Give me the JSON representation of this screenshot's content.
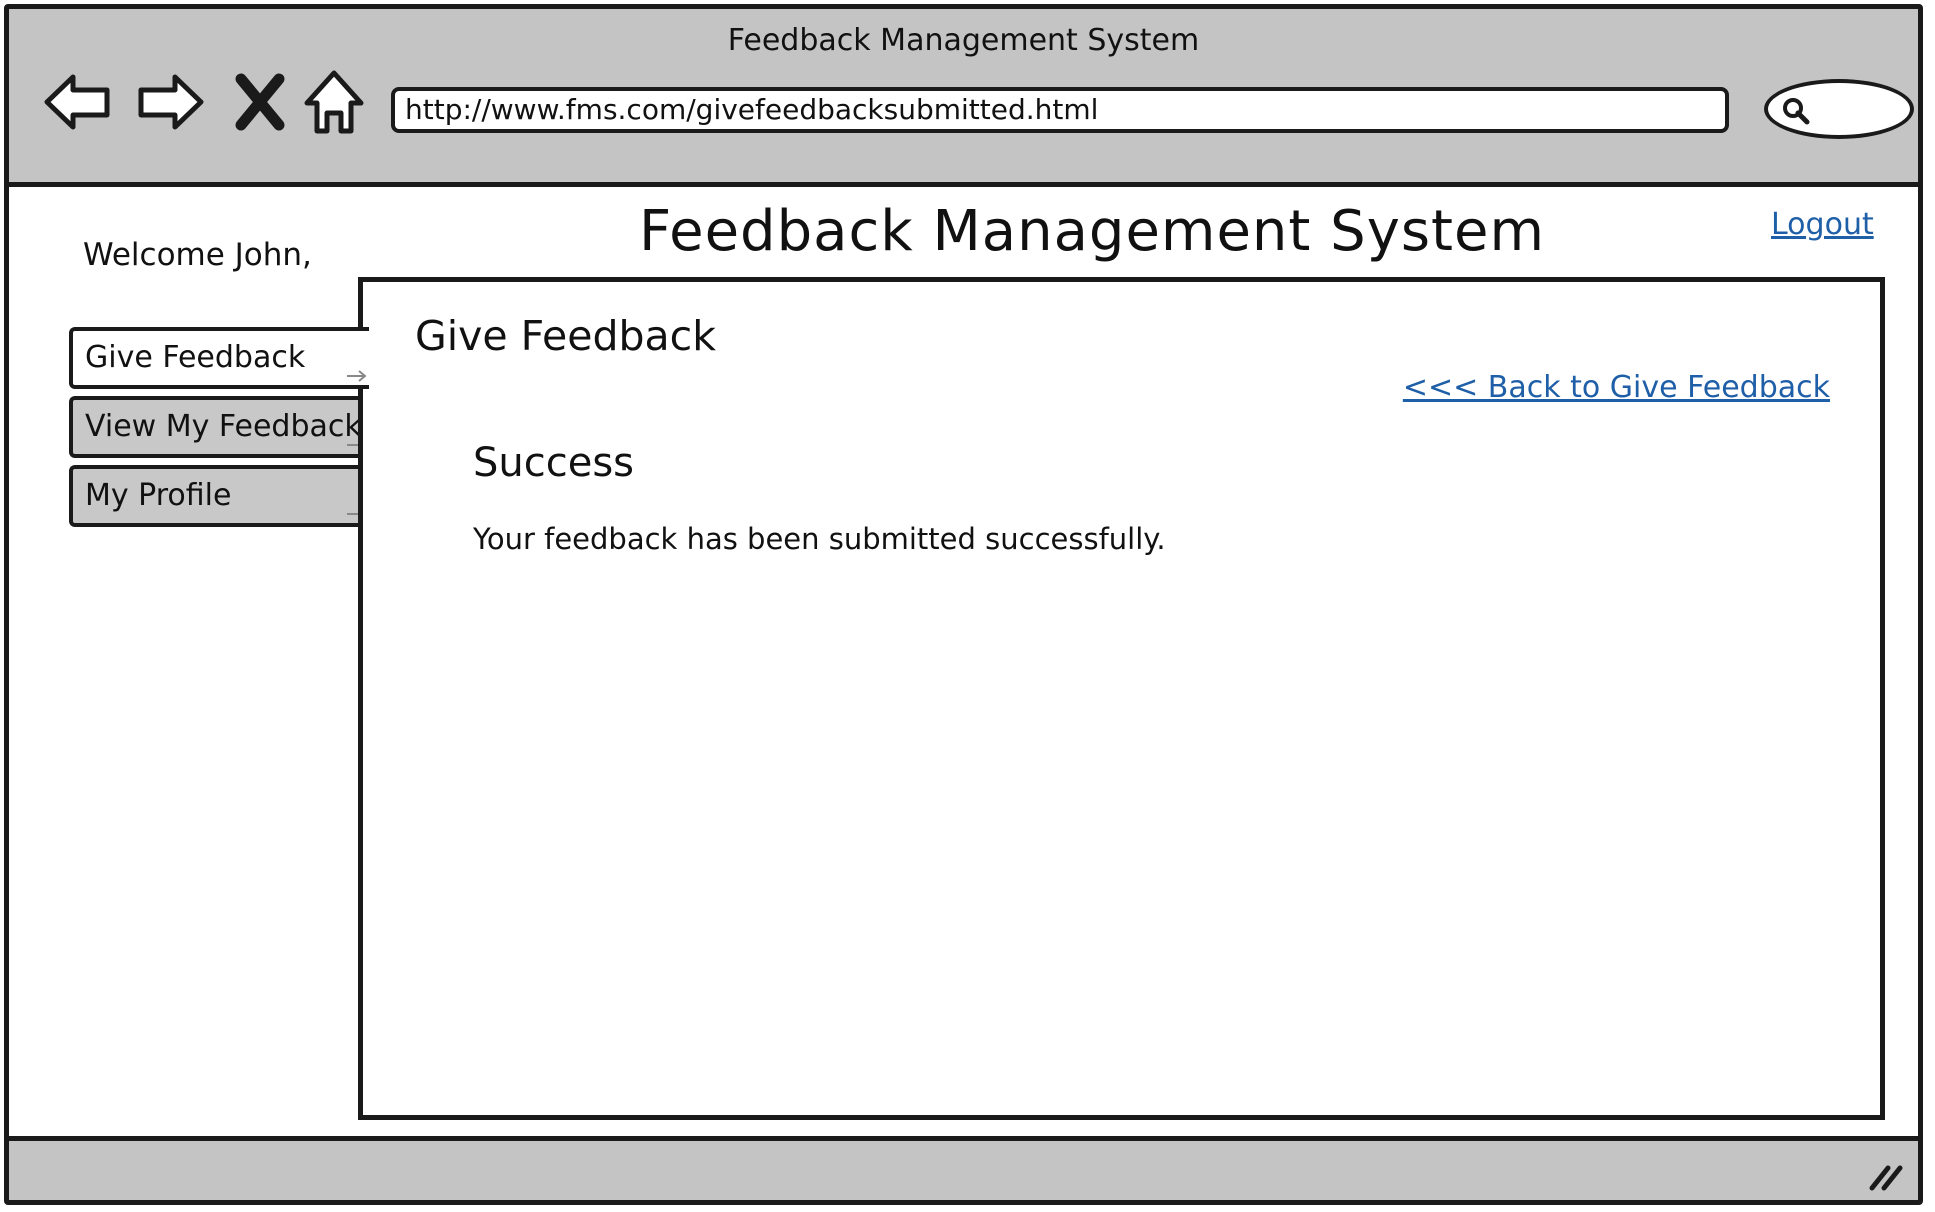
{
  "window": {
    "title": "Feedback Management System"
  },
  "browser": {
    "url": "http://www.fms.com/givefeedbacksubmitted.html",
    "icons": [
      "back-arrow-icon",
      "forward-arrow-icon",
      "close-icon",
      "home-icon",
      "search-icon"
    ]
  },
  "header": {
    "welcome": "Welcome John,",
    "title": "Feedback Management System",
    "logout_label": "Logout"
  },
  "sidebar": {
    "items": [
      {
        "label": "Give Feedback",
        "active": true
      },
      {
        "label": "View My Feedback",
        "active": false
      },
      {
        "label": "My Profile",
        "active": false
      }
    ]
  },
  "main": {
    "panel_title": "Give Feedback",
    "back_link_label": "<<< Back to Give Feedback",
    "success_heading": "Success",
    "success_message": "Your feedback has been submitted successfully."
  },
  "colors": {
    "chrome": "#c4c4c4",
    "link": "#1f5fa8",
    "border": "#1a1a1a"
  }
}
